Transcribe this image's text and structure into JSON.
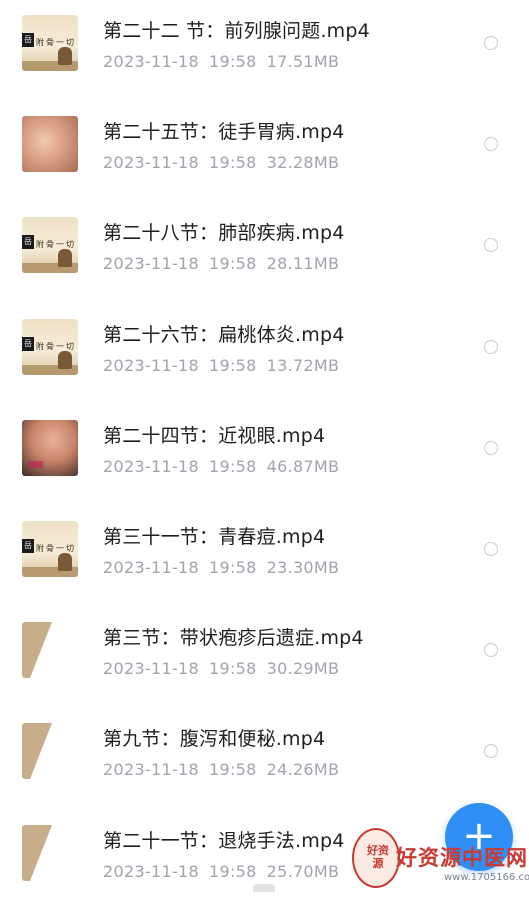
{
  "files": [
    {
      "title": "第二十二 节：前列腺问题.mp4",
      "date": "2023-11-18",
      "time": "19:58",
      "size": "17.51MB",
      "thumb": "book"
    },
    {
      "title": "第二十五节：徒手胃病.mp4",
      "date": "2023-11-18",
      "time": "19:58",
      "size": "32.28MB",
      "thumb": "skin"
    },
    {
      "title": "第二十八节：肺部疾病.mp4",
      "date": "2023-11-18",
      "time": "19:58",
      "size": "28.11MB",
      "thumb": "book"
    },
    {
      "title": "第二十六节：扁桃体炎.mp4",
      "date": "2023-11-18",
      "time": "19:58",
      "size": "13.72MB",
      "thumb": "book"
    },
    {
      "title": "第二十四节：近视眼.mp4",
      "date": "2023-11-18",
      "time": "19:58",
      "size": "46.87MB",
      "thumb": "skin2"
    },
    {
      "title": "第三十一节：青春痘.mp4",
      "date": "2023-11-18",
      "time": "19:58",
      "size": "23.30MB",
      "thumb": "book"
    },
    {
      "title": "第三节：带状疱疹后遗症.mp4",
      "date": "2023-11-18",
      "time": "19:58",
      "size": "30.29MB",
      "thumb": "slant"
    },
    {
      "title": "第九节：腹泻和便秘.mp4",
      "date": "2023-11-18",
      "time": "19:58",
      "size": "24.26MB",
      "thumb": "slant"
    },
    {
      "title": "第二十一节：退烧手法.mp4",
      "date": "2023-11-18",
      "time": "19:58",
      "size": "25.70MB",
      "thumb": "slant"
    }
  ],
  "fab": {
    "label": "+",
    "icon": "plus-icon",
    "color": "#2f8ff5"
  },
  "watermark": {
    "seal": "好资源",
    "text": "好资源中医网",
    "url": "www.1705166.com"
  },
  "colors": {
    "title": "#1f1f1f",
    "meta": "#a0a4ad",
    "accent": "#2f8ff5",
    "watermark": "#c93a32"
  }
}
